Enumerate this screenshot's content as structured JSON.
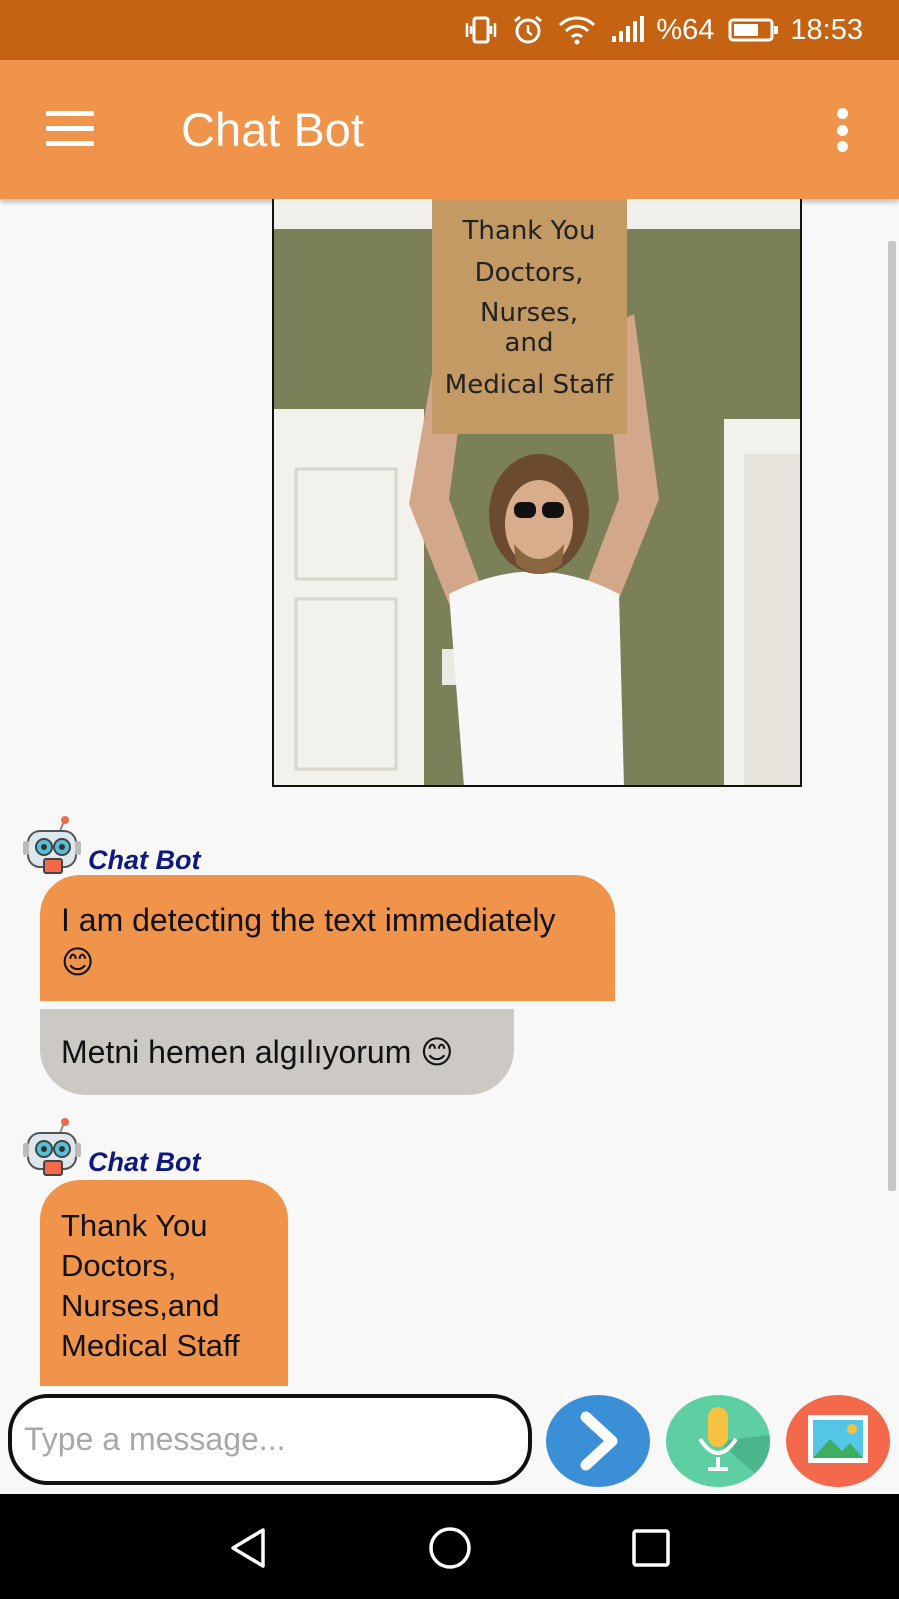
{
  "status_bar": {
    "battery": "%64",
    "time": "18:53",
    "icons": [
      "vibrate-icon",
      "alarm-icon",
      "wifi-icon",
      "signal-icon",
      "battery-icon"
    ]
  },
  "app_bar": {
    "title": "Chat Bot",
    "icons": [
      "hamburger-menu-icon",
      "overflow-menu-icon"
    ]
  },
  "chat": {
    "photo_sign_text": [
      "Thank You",
      "Doctors,",
      "Nurses,",
      "and",
      "Medical Staff"
    ],
    "messages": [
      {
        "sender": "Chat Bot",
        "avatar_icon": "robot-avatar-icon",
        "text_en": "I am detecting the text immediately 😊",
        "text_tr": "Metni hemen algılıyorum 😊"
      },
      {
        "sender": "Chat Bot",
        "avatar_icon": "robot-avatar-icon",
        "text_en": "Thank You Doctors, Nurses,and Medical Staff"
      }
    ]
  },
  "input": {
    "placeholder": "Type a message...",
    "value": "",
    "buttons": [
      "send-icon",
      "microphone-icon",
      "gallery-icon"
    ],
    "colors": {
      "send": "#3a8fd6",
      "mic": "#5dcfa3",
      "gallery": "#f4694c"
    }
  },
  "nav_bar": {
    "icons": [
      "back-icon",
      "home-icon",
      "recents-icon"
    ]
  },
  "colors": {
    "status_bar": "#c66313",
    "app_bar": "#ef944a",
    "bubble_bot": "#ef944a",
    "bubble_translation": "#ccc8c4",
    "sender_name": "#0d1880"
  }
}
